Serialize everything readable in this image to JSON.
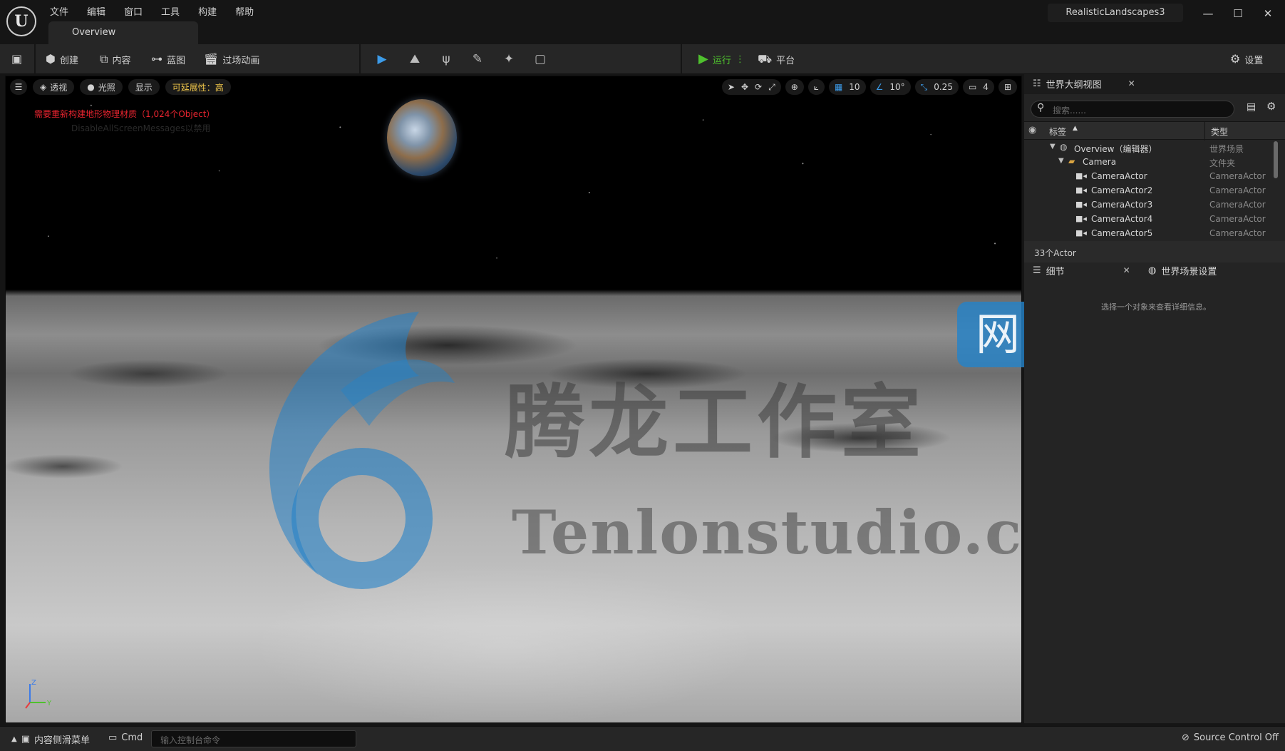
{
  "window": {
    "project_name": "RealisticLandscapes3",
    "minimize": "—",
    "maximize": "☐",
    "close": "✕"
  },
  "menu": [
    "文件",
    "编辑",
    "窗口",
    "工具",
    "构建",
    "帮助"
  ],
  "doc_tab": "Overview",
  "toolbar": {
    "create": "创建",
    "content": "内容",
    "blueprint": "蓝图",
    "cinematics": "过场动画",
    "play": "运行",
    "platforms": "平台",
    "settings": "设置"
  },
  "viewport": {
    "perspective": "透视",
    "lit": "光照",
    "show": "显示",
    "scalability": "可延展性：高",
    "grid_snap": "10",
    "rotation_snap": "10°",
    "scale_snap": "0.25",
    "camera_speed": "4",
    "warning": "需要重新构建地形物理材质（1,024个Object）",
    "warning_sub": "DisableAllScreenMessages以禁用",
    "axis_y": "Y",
    "axis_z": "Z"
  },
  "watermark": {
    "cn": "腾龙工作室",
    "site": "网站",
    "en": "Tenlonstudio.com"
  },
  "outliner": {
    "tab_title": "世界大纲视图",
    "search_placeholder": "搜索......",
    "col_label": "标签",
    "col_type": "类型",
    "rows": [
      {
        "name": "Overview（编辑器）",
        "type": "世界场景"
      },
      {
        "name": "Camera",
        "type": "文件夹"
      },
      {
        "name": "CameraActor",
        "type": "CameraActor"
      },
      {
        "name": "CameraActor2",
        "type": "CameraActor"
      },
      {
        "name": "CameraActor3",
        "type": "CameraActor"
      },
      {
        "name": "CameraActor4",
        "type": "CameraActor"
      },
      {
        "name": "CameraActor5",
        "type": "CameraActor"
      }
    ],
    "count": "33个Actor"
  },
  "details": {
    "tab_title": "细节",
    "world_settings_tab": "世界场景设置",
    "empty_message": "选择一个对象来查看详细信息。"
  },
  "statusbar": {
    "content_drawer": "内容侧滑菜单",
    "cmd": "Cmd",
    "console_placeholder": "输入控制台命令",
    "source_control": "Source Control Off"
  },
  "colors": {
    "accent_play": "#4fc12e",
    "warning": "#e8242f",
    "scalability": "#f2c84b",
    "watermark_blue": "#2482c8"
  }
}
